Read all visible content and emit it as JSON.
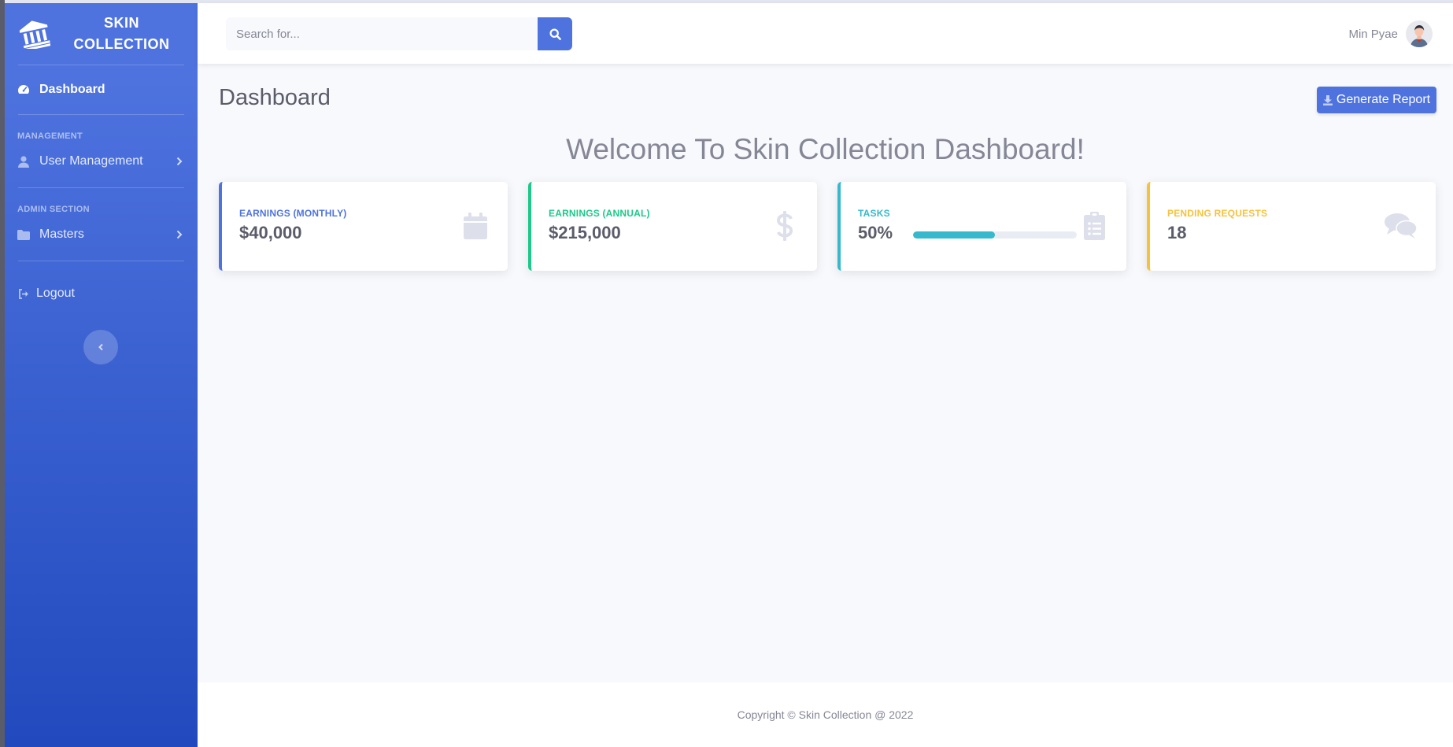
{
  "colors": {
    "primary": "#4e73df",
    "success": "#1cc88a",
    "info": "#36b9cc",
    "warning": "#f6c23e",
    "text_gray": "#5a5c69",
    "muted_icon": "#dddfeb"
  },
  "sidebar": {
    "brand_line1": "SKIN",
    "brand_line2": "COLLECTION",
    "brand_icon": "university-icon",
    "items": [
      {
        "label": "Dashboard",
        "icon": "tachometer-icon",
        "active": true
      },
      {
        "heading": "MANAGEMENT"
      },
      {
        "label": "User Management",
        "icon": "user-icon",
        "chevron": true
      },
      {
        "heading": "ADMIN SECTION"
      },
      {
        "label": "Masters",
        "icon": "folder-icon",
        "chevron": true
      },
      {
        "label": "Logout",
        "icon": "sign-out-icon"
      }
    ],
    "toggle_icon": "chevron-left-icon"
  },
  "topbar": {
    "search_placeholder": "Search for...",
    "search_icon": "search-icon",
    "user_name": "Min Pyae",
    "avatar_icon": "avatar-icon"
  },
  "page": {
    "title": "Dashboard",
    "report_button": "Generate Report",
    "report_icon": "download-icon",
    "welcome": "Welcome To Skin Collection Dashboard!"
  },
  "cards": [
    {
      "label": "Earnings (Monthly)",
      "value": "$40,000",
      "color": "#4e73df",
      "icon": "calendar-icon"
    },
    {
      "label": "Earnings (Annual)",
      "value": "$215,000",
      "color": "#1cc88a",
      "icon": "dollar-icon"
    },
    {
      "label": "Tasks",
      "value": "50%",
      "progress": 0.5,
      "color": "#36b9cc",
      "icon": "clipboard-list-icon"
    },
    {
      "label": "Pending Requests",
      "value": "18",
      "color": "#f6c23e",
      "icon": "comments-icon"
    }
  ],
  "footer": {
    "text": "Copyright © Skin Collection @ 2022"
  }
}
